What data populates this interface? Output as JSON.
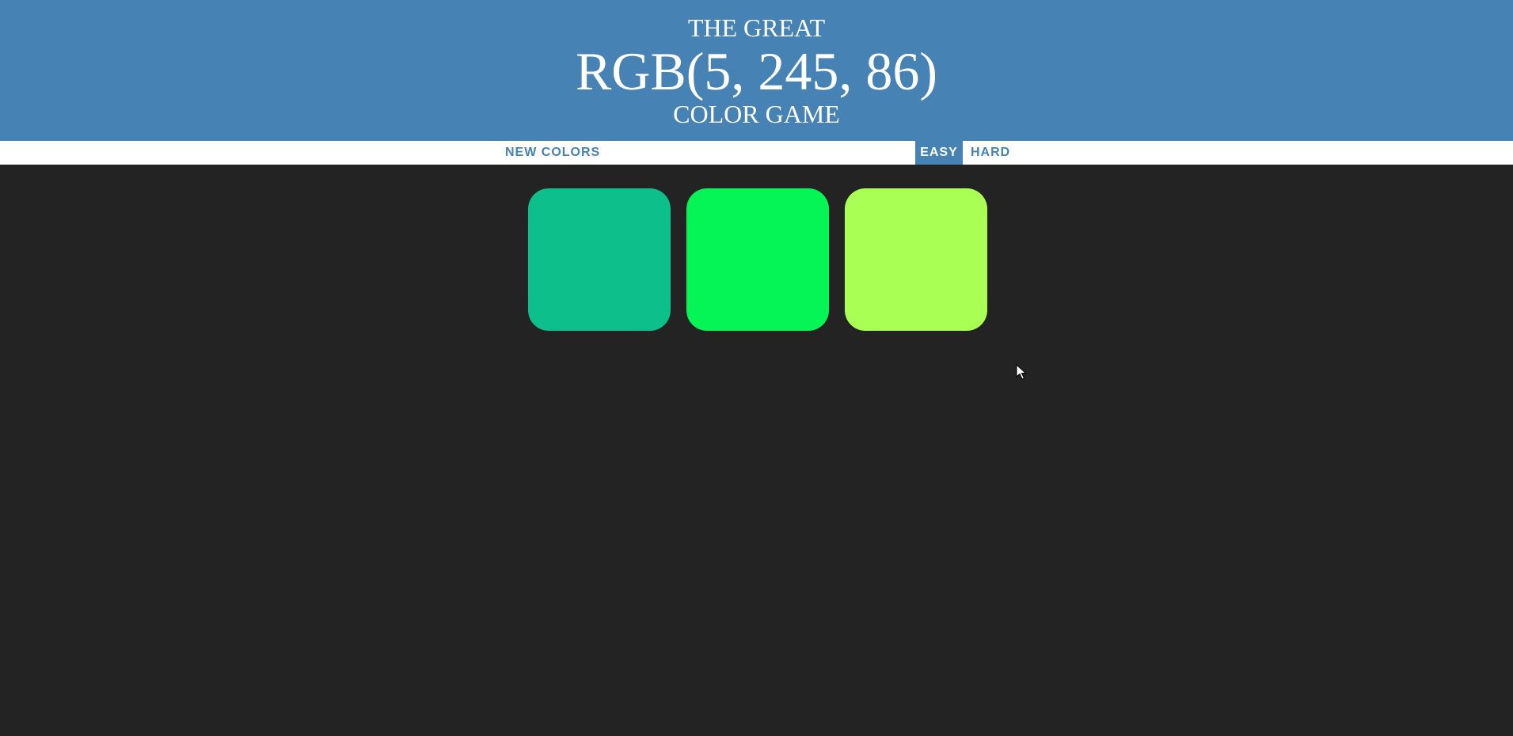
{
  "header": {
    "line1": "THE GREAT",
    "target_color": "RGB(5, 245, 86)",
    "line3": "COLOR GAME"
  },
  "controls": {
    "new_colors_label": "NEW COLORS",
    "message": "",
    "easy_label": "EASY",
    "hard_label": "HARD",
    "selected_mode": "EASY"
  },
  "squares": [
    {
      "color": "#0DBF8B"
    },
    {
      "color": "#05F556"
    },
    {
      "color": "#AAFF54"
    }
  ],
  "colors": {
    "header_bg": "#4682B4",
    "board_bg": "#232323",
    "stripe_bg": "#FFFFFF",
    "accent": "#4682B4"
  },
  "icons": {
    "cursor": "mouse-pointer-icon"
  }
}
